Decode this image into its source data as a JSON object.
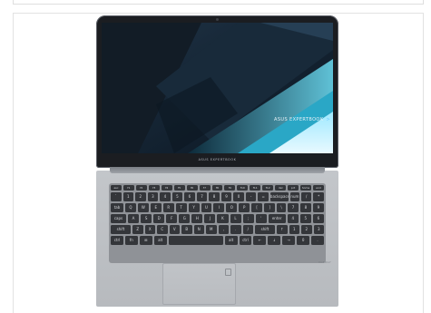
{
  "laptop": {
    "screen_brand_text": "ASUS EXPERTBOOK",
    "screen_chevron": ">",
    "bezel_label": "ASUS EXPERTBOOK",
    "deck_badge": "ENERGY"
  },
  "keyboard": {
    "rows": [
      [
        "esc",
        "f1",
        "f2",
        "f3",
        "f4",
        "f5",
        "f6",
        "f7",
        "f8",
        "f9",
        "f10",
        "f11",
        "f12",
        "del",
        "prt",
        "home",
        "end"
      ],
      [
        "`",
        "1",
        "2",
        "3",
        "4",
        "5",
        "6",
        "7",
        "8",
        "9",
        "0",
        "-",
        "=",
        "backspace",
        "num",
        "/",
        "*"
      ],
      [
        "tab",
        "Q",
        "W",
        "E",
        "R",
        "T",
        "Y",
        "U",
        "I",
        "O",
        "P",
        "[",
        "]",
        "\\",
        "7",
        "8",
        "9"
      ],
      [
        "caps",
        "A",
        "S",
        "D",
        "F",
        "G",
        "H",
        "J",
        "K",
        "L",
        ";",
        "'",
        "enter",
        "4",
        "5",
        "6"
      ],
      [
        "shift",
        "Z",
        "X",
        "C",
        "V",
        "B",
        "N",
        "M",
        ",",
        ".",
        "/",
        "shift",
        "↑",
        "1",
        "2",
        "3"
      ],
      [
        "ctrl",
        "fn",
        "⊞",
        "alt",
        "",
        "alt",
        "ctrl",
        "←",
        "↓",
        "→",
        "0",
        "."
      ]
    ]
  },
  "colors": {
    "body": "#bcbfc3",
    "keys": "#34363a",
    "lid": "#1b1d21",
    "accent": "#7fd2ff"
  }
}
